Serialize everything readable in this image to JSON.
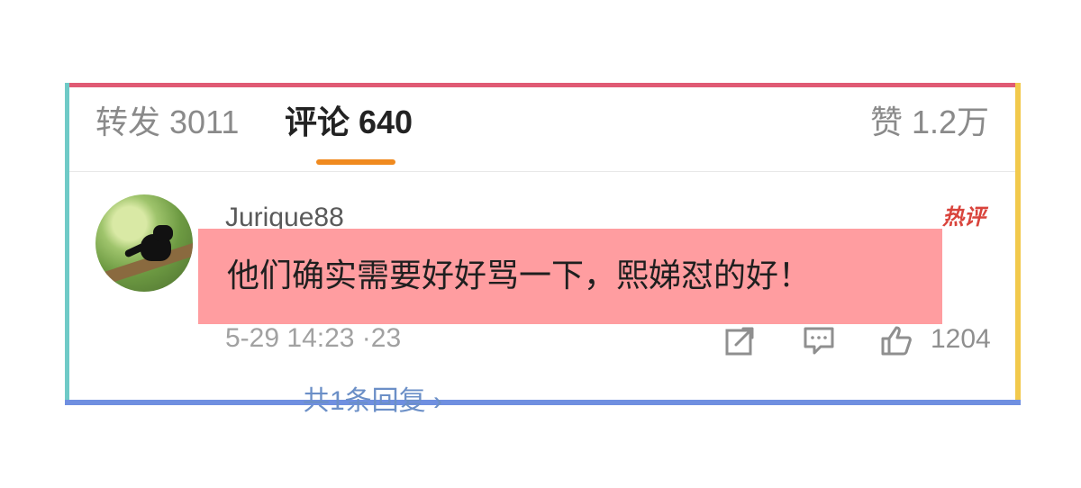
{
  "tabs": [
    {
      "label": "转发 3011",
      "state": "inactive"
    },
    {
      "label": "评论 640",
      "state": "active"
    },
    {
      "label": "赞 1.2万",
      "state": "inactive"
    }
  ],
  "comment": {
    "username": "Jurique88",
    "badge": "热评",
    "text": "他们确实需要好好骂一下，熙娣怼的好！",
    "timestamp": "5-29 14:23 ·23",
    "like_count": "1204",
    "reply_summary": "共1条回复 ›"
  },
  "icons": {
    "share": "share-icon",
    "comment": "comment-icon",
    "like": "like-icon"
  },
  "colors": {
    "active_tab_indicator": "#f08a1f",
    "hot_badge": "#d9443c",
    "highlight": "#ff9da0",
    "border_top": "#e05a74",
    "border_left": "#6fcac7",
    "border_right": "#f2c94c",
    "border_bottom": "#6f8fe0"
  }
}
